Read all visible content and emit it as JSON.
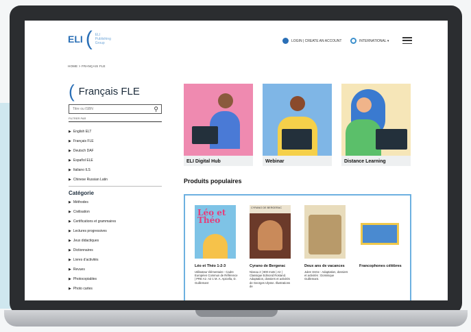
{
  "header": {
    "logo_mark": "ELI",
    "logo_text": "ELI Publishing Group",
    "login_label": "LOGIN | CREATE AN ACCOUNT",
    "intl_label": "INTERNATIONAL ▾"
  },
  "breadcrumb": "HOME > FRANÇAIS FLE",
  "sidebar": {
    "title": "Français FLE",
    "search_placeholder": "Titre ou ISBN",
    "filter_label": "FILTRER PAR",
    "languages": [
      {
        "label": "English ELT"
      },
      {
        "label": "Français FLE"
      },
      {
        "label": "Deutsch DAF"
      },
      {
        "label": "Español ELE"
      },
      {
        "label": "Italiano ILS"
      },
      {
        "label": "Chinese Russian Latin"
      }
    ],
    "category_title": "Catégorie",
    "categories": [
      {
        "label": "Méthodes"
      },
      {
        "label": "Civilisation"
      },
      {
        "label": "Certifications et grammaires"
      },
      {
        "label": "Lectures progressives"
      },
      {
        "label": "Jeux didactiques"
      },
      {
        "label": "Dictionnaires"
      },
      {
        "label": "Livres d’activités"
      },
      {
        "label": "Revues"
      },
      {
        "label": "Photocopiables"
      },
      {
        "label": "Photo cartes"
      }
    ]
  },
  "tiles": [
    {
      "label": "ELI Digital Hub"
    },
    {
      "label": "Webinar"
    },
    {
      "label": "Distance Learning"
    }
  ],
  "popular": {
    "title": "Produits populaires",
    "books": [
      {
        "cover_text": "Léo et Théo",
        "title": "Léo et Théo 1-2-3",
        "desc": "Utilisateur élémentaire - Cadre Européen Commun de Référence | PRE A1- A2 1 M. A. Apicella, D. Guillemant"
      },
      {
        "cover_text": "CYRANO DE BERGERAC",
        "title": "Cyrano de Bergerac",
        "desc": "Niveau 2 | 800 mots | A2 | Classique Edmond Rostand. Adaptation, dossiers et activités de Georges Ulysse. Illustrations de"
      },
      {
        "cover_text": "",
        "title": "Deux ans de vacances",
        "desc": "Jules Verne - Adaptation, dossiers et activités : Dominique Guillemant."
      },
      {
        "cover_text": "",
        "title": "Francophones célèbres",
        "desc": ""
      }
    ]
  },
  "colors": {
    "accent": "#2a6fb6",
    "tile1": "#ef8ab0",
    "tile2": "#7fb6e6",
    "tile3": "#f6e6b8",
    "popular_border": "#6cb0e0"
  }
}
